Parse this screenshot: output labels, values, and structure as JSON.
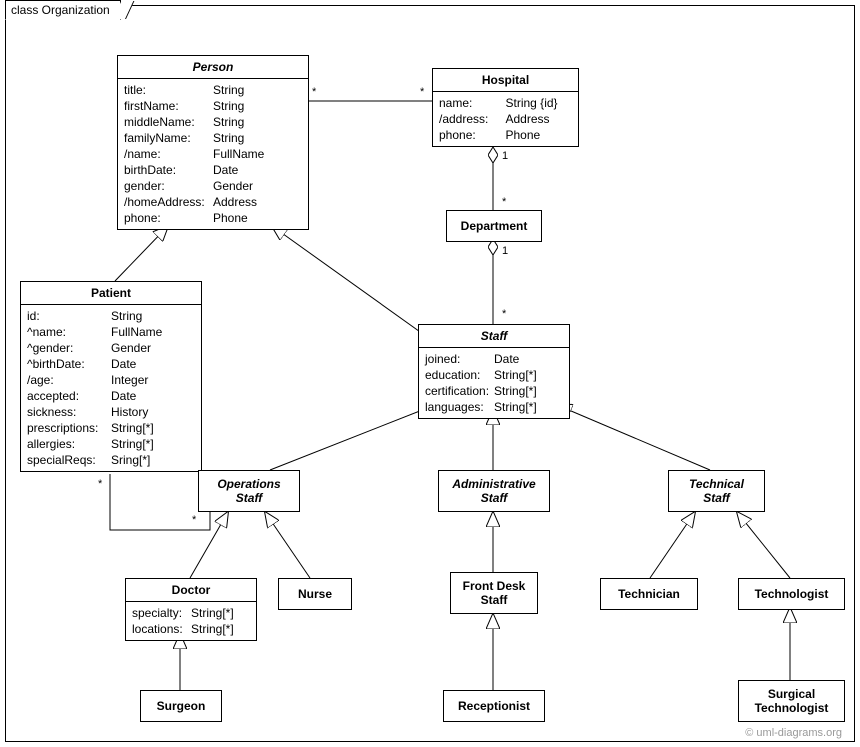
{
  "package": {
    "label": "class Organization"
  },
  "classes": {
    "person": {
      "name": "Person",
      "attrs": [
        "title:",
        "firstName:",
        "middleName:",
        "familyName:",
        "/name:",
        "birthDate:",
        "gender:",
        "/homeAddress:",
        "phone:"
      ],
      "types": [
        "String",
        "String",
        "String",
        "String",
        "FullName",
        "Date",
        "Gender",
        "Address",
        "Phone"
      ]
    },
    "hospital": {
      "name": "Hospital",
      "attrs": [
        "name:",
        "/address:",
        "phone:"
      ],
      "types": [
        "String {id}",
        "Address",
        "Phone"
      ]
    },
    "department": {
      "name": "Department"
    },
    "patient": {
      "name": "Patient",
      "attrs": [
        "id:",
        "^name:",
        "^gender:",
        "^birthDate:",
        "/age:",
        "accepted:",
        "sickness:",
        "prescriptions:",
        "allergies:",
        "specialReqs:"
      ],
      "types": [
        "String",
        "FullName",
        "Gender",
        "Date",
        "Integer",
        "Date",
        "History",
        "String[*]",
        "String[*]",
        "Sring[*]"
      ]
    },
    "staff": {
      "name": "Staff",
      "attrs": [
        "joined:",
        "education:",
        "certification:",
        "languages:"
      ],
      "types": [
        "Date",
        "String[*]",
        "String[*]",
        "String[*]"
      ]
    },
    "opsStaff": {
      "name1": "Operations",
      "name2": "Staff"
    },
    "adminStaff": {
      "name1": "Administrative",
      "name2": "Staff"
    },
    "techStaff": {
      "name1": "Technical",
      "name2": "Staff"
    },
    "doctor": {
      "name": "Doctor",
      "attrs": [
        "specialty:",
        "locations:"
      ],
      "types": [
        "String[*]",
        "String[*]"
      ]
    },
    "nurse": {
      "name": "Nurse"
    },
    "frontDesk": {
      "name1": "Front Desk",
      "name2": "Staff"
    },
    "technician": {
      "name": "Technician"
    },
    "technologist": {
      "name": "Technologist"
    },
    "surgeon": {
      "name": "Surgeon"
    },
    "receptionist": {
      "name": "Receptionist"
    },
    "surgTech": {
      "name1": "Surgical",
      "name2": "Technologist"
    }
  },
  "mults": {
    "star": "*",
    "one": "1"
  },
  "watermark": "© uml-diagrams.org"
}
